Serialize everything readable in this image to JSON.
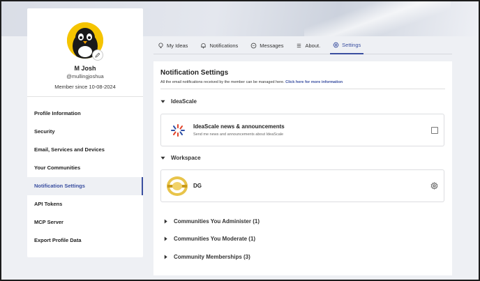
{
  "profile": {
    "name": "M Josh",
    "handle": "@mullingjoshua",
    "member_since": "Member since 10-08-2024",
    "menu": [
      {
        "label": "Profile Information",
        "active": false
      },
      {
        "label": "Security",
        "active": false
      },
      {
        "label": "Email, Services and Devices",
        "active": false
      },
      {
        "label": "Your Communities",
        "active": false
      },
      {
        "label": "Notification Settings",
        "active": true
      },
      {
        "label": "API Tokens",
        "active": false
      },
      {
        "label": "MCP Server",
        "active": false
      },
      {
        "label": "Export Profile Data",
        "active": false
      }
    ]
  },
  "tabs": [
    {
      "label": "My Ideas",
      "icon": "lightbulb-icon",
      "active": false
    },
    {
      "label": "Notifications",
      "icon": "bell-icon",
      "active": false
    },
    {
      "label": "Messages",
      "icon": "chat-bubble-icon",
      "active": false
    },
    {
      "label": "About.",
      "icon": "list-icon",
      "active": false
    },
    {
      "label": "Settings",
      "icon": "gear-icon",
      "active": true
    }
  ],
  "main": {
    "title": "Notification Settings",
    "description": "All the email notifications received by the member can be managed here.",
    "description_link": "Click here for more information",
    "ideascale_section": {
      "heading": "IdeaScale",
      "item_title": "IdeaScale news & announcements",
      "item_desc": "Send me news and announcements about IdeaScale",
      "checked": false
    },
    "workspace_section": {
      "heading": "Workspace",
      "item_title": "DG"
    },
    "collapsibles": [
      "Communities You Administer (1)",
      "Communities You Moderate (1)",
      "Community Memberships (3)"
    ]
  },
  "colors": {
    "accent": "#3a4fa0",
    "avatar_bg": "#f5c400"
  }
}
